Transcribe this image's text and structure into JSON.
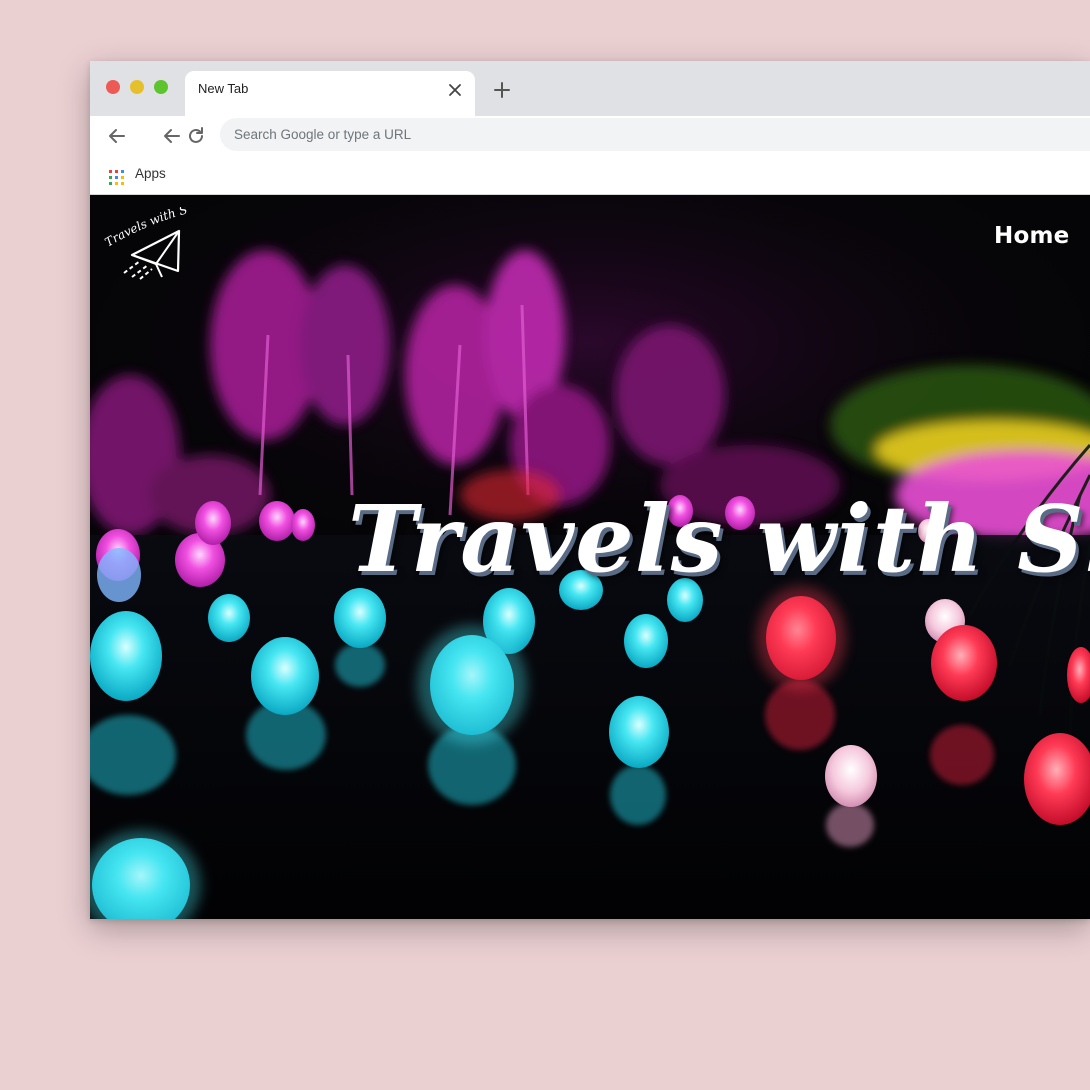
{
  "browser": {
    "tab_title": "New Tab",
    "address_placeholder": "Search Google or type a URL",
    "bookmarks": [
      {
        "label": "Apps"
      }
    ]
  },
  "site": {
    "logo_text": "Travels with Sky",
    "nav": [
      {
        "label": "Home"
      }
    ],
    "hero_title": "Travels with Sky"
  },
  "colors": {
    "background": "#ebd0d2",
    "cyan_glow": "#2fd6ea",
    "magenta_glow": "#e23fd6",
    "red_glow": "#ff2e4c"
  }
}
